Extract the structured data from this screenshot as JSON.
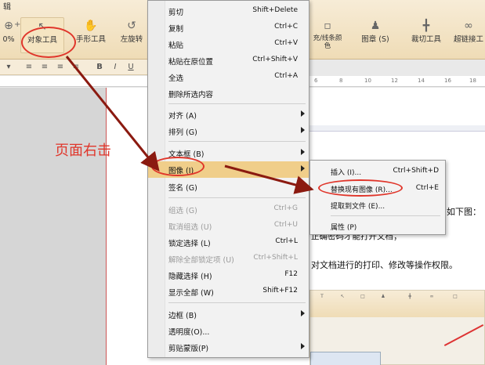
{
  "ribbon": {
    "title_fragment": "辑",
    "left_fragment": "0%",
    "plus_fragment": "+",
    "buttons": [
      {
        "label": "对象工具",
        "icon": "pointer-icon"
      },
      {
        "label": "手形工具",
        "icon": "hand-icon"
      },
      {
        "label": "左旋转",
        "icon": "rotate-left-icon"
      },
      {
        "label": "充/线条颜\n色",
        "icon": "fill-color-icon"
      },
      {
        "label": "图章 (S)",
        "icon": "stamp-icon"
      },
      {
        "label": "裁切工具",
        "icon": "crop-icon"
      },
      {
        "label": "超链接工",
        "icon": "link-icon"
      }
    ]
  },
  "toolbar2": {
    "bold": "B",
    "italic": "I",
    "underline": "U"
  },
  "ruler_marks": [
    "6",
    "8",
    "10",
    "12",
    "14",
    "16",
    "18"
  ],
  "annotation": {
    "label": "页面右击",
    "color": "#e0362b"
  },
  "context_menu": {
    "items": [
      {
        "label": "剪切",
        "shortcut": "Shift+Delete"
      },
      {
        "label": "复制",
        "shortcut": "Ctrl+C"
      },
      {
        "label": "粘贴",
        "shortcut": "Ctrl+V"
      },
      {
        "label": "粘贴在原位置",
        "shortcut": "Ctrl+Shift+V"
      },
      {
        "label": "全选",
        "shortcut": "Ctrl+A"
      },
      {
        "label": "删除所选内容",
        "shortcut": ""
      },
      {
        "label": "对齐 (A)",
        "shortcut": "",
        "submenu": true
      },
      {
        "label": "排列 (G)",
        "shortcut": "",
        "submenu": true
      },
      {
        "label": "文本框 (B)",
        "shortcut": "",
        "submenu": true
      },
      {
        "label": "图像 (I)",
        "shortcut": "",
        "submenu": true,
        "highlighted": true
      },
      {
        "label": "签名 (G)",
        "shortcut": "",
        "submenu": true
      },
      {
        "label": "组选 (G)",
        "shortcut": "Ctrl+G",
        "disabled": true
      },
      {
        "label": "取消组选 (U)",
        "shortcut": "Ctrl+U",
        "disabled": true
      },
      {
        "label": "锁定选择 (L)",
        "shortcut": "Ctrl+L"
      },
      {
        "label": "解除全部锁定项 (U)",
        "shortcut": "Ctrl+Shift+L",
        "disabled": true
      },
      {
        "label": "隐藏选择 (H)",
        "shortcut": "F12"
      },
      {
        "label": "显示全部 (W)",
        "shortcut": "Shift+F12"
      },
      {
        "label": "边框 (B)",
        "shortcut": "",
        "submenu": true
      },
      {
        "label": "透明度(O)...",
        "shortcut": ""
      },
      {
        "label": "剪贴蒙版(P)",
        "shortcut": "",
        "submenu": true
      }
    ]
  },
  "submenu": {
    "items": [
      {
        "label": "插入 (I)...",
        "shortcut": "Ctrl+Shift+D"
      },
      {
        "label": "替换现有图像 (R)...",
        "shortcut": "Ctrl+E"
      },
      {
        "label": "提取到文件 (E)...",
        "shortcut": ""
      },
      {
        "label": "属性 (P)",
        "shortcut": ""
      }
    ]
  },
  "document": {
    "line_a": "如下图：",
    "line_b": "正确密码才能打开文档；",
    "line_c": "对文档进行的打印、修改等操作权限。"
  }
}
